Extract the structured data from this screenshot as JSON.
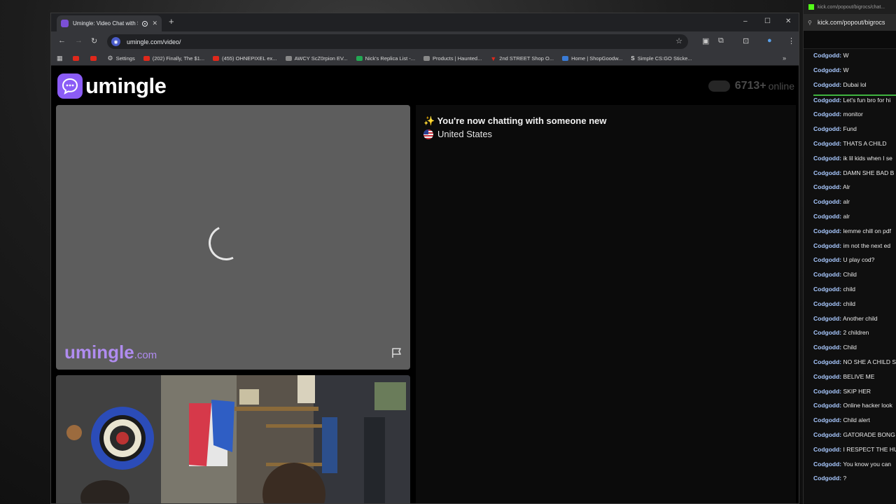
{
  "browser": {
    "tab_title": "Umingle: Video Chat with S",
    "new_tab": "+",
    "url": "umingle.com/video/",
    "window_controls": {
      "minimize": "–",
      "maximize": "☐",
      "close": "✕"
    }
  },
  "bookmarks": [
    {
      "label": "",
      "icon": "youtube-icon"
    },
    {
      "label": "",
      "icon": "youtube-icon"
    },
    {
      "label": "Settings",
      "icon": "gear-icon"
    },
    {
      "label": "(202) Finally, The $1...",
      "icon": "youtube-icon"
    },
    {
      "label": "(455) OHNEPIXEL ex...",
      "icon": "youtube-icon"
    },
    {
      "label": "AWCY ScZ0rpion EV...",
      "icon": "bag-icon"
    },
    {
      "label": "Nick's Replica List -...",
      "icon": "sheets-icon"
    },
    {
      "label": "Products | Haunted...",
      "icon": "skull-icon"
    },
    {
      "label": "2nd STREET Shop O...",
      "icon": "v-icon"
    },
    {
      "label": "Home | ShopGoodw...",
      "icon": "goodwill-icon"
    },
    {
      "label": "Simple CS:GO Sticke...",
      "icon": "s-icon"
    }
  ],
  "bookmarks_more": "»",
  "site": {
    "logo_text": "umingle",
    "online_count": "6713+",
    "online_label": "online",
    "watermark_name": "umingle",
    "watermark_domain": ".com",
    "chat_status": "✨ You're now chatting with someone new",
    "country": "United States"
  },
  "kick": {
    "title": "kick.com/popout/bigrocs/chat...",
    "url": "kick.com/popout/bigrocs",
    "messages_before_divider": [
      {
        "user": "Codgodd:",
        "text": "W"
      },
      {
        "user": "Codgodd:",
        "text": "W"
      },
      {
        "user": "Codgodd:",
        "text": "Dubai lol"
      }
    ],
    "messages": [
      {
        "user": "Codgodd:",
        "text": "Let's fun bro for hi"
      },
      {
        "user": "Codgodd:",
        "text": "monitor"
      },
      {
        "user": "Codgodd:",
        "text": "Fund"
      },
      {
        "user": "Codgodd:",
        "text": "THATS A CHILD"
      },
      {
        "user": "Codgodd:",
        "text": "ik lil kids when I se"
      },
      {
        "user": "Codgodd:",
        "text": "DAMN SHE BAD B"
      },
      {
        "user": "Codgodd:",
        "text": "Alr"
      },
      {
        "user": "Codgodd:",
        "text": "alr"
      },
      {
        "user": "Codgodd:",
        "text": "alr"
      },
      {
        "user": "Codgodd:",
        "text": "lemme chill on pdf"
      },
      {
        "user": "Codgodd:",
        "text": "im not the next ed"
      },
      {
        "user": "Codgodd:",
        "text": "U play cod?"
      },
      {
        "user": "Codgodd:",
        "text": "Child"
      },
      {
        "user": "Codgodd:",
        "text": "child"
      },
      {
        "user": "Codgodd:",
        "text": "child"
      },
      {
        "user": "Codgodd:",
        "text": "Another child"
      },
      {
        "user": "Codgodd:",
        "text": "2 children"
      },
      {
        "user": "Codgodd:",
        "text": "Child"
      },
      {
        "user": "Codgodd:",
        "text": "NO SHE A CHILD S"
      },
      {
        "user": "Codgodd:",
        "text": "BELIVE ME"
      },
      {
        "user": "Codgodd:",
        "text": "SKIP HER"
      },
      {
        "user": "Codgodd:",
        "text": "Online hacker look"
      },
      {
        "user": "Codgodd:",
        "text": "Child alert"
      },
      {
        "user": "Codgodd:",
        "text": "GATORADE BONG"
      },
      {
        "user": "Codgodd:",
        "text": "I RESPECT THE HU"
      },
      {
        "user": "Codgodd:",
        "text": "You know you can"
      },
      {
        "user": "Codgodd:",
        "text": "?"
      }
    ]
  }
}
